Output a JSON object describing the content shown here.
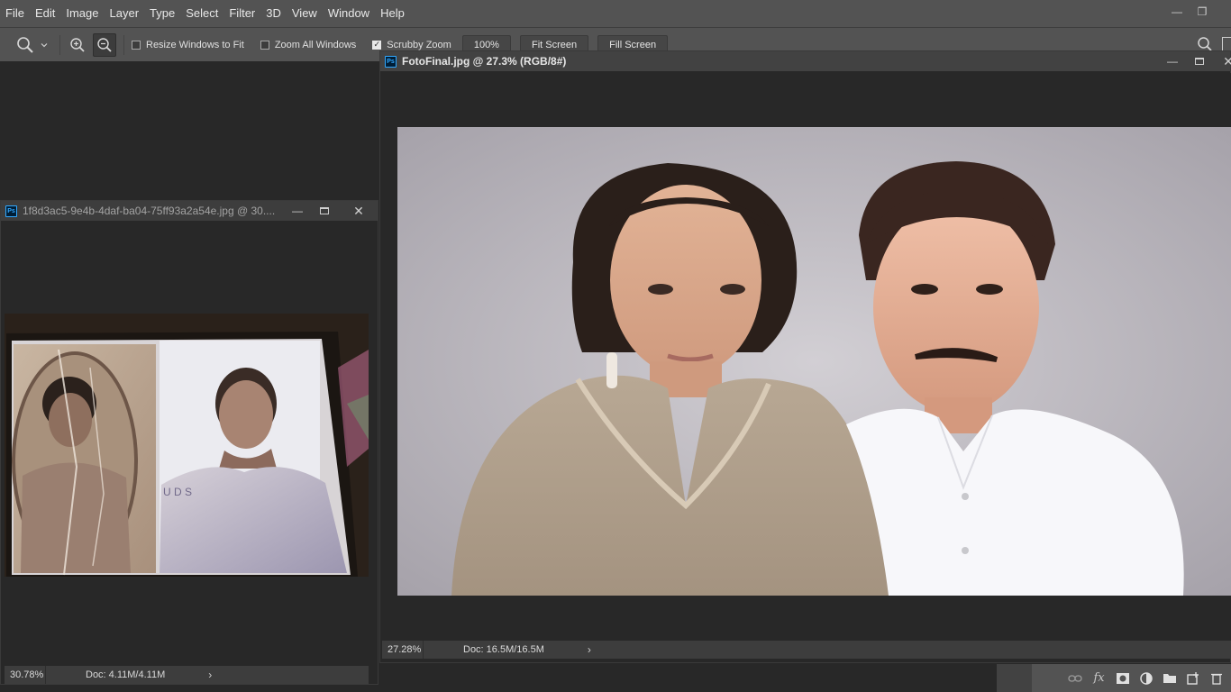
{
  "menu": [
    "File",
    "Edit",
    "Image",
    "Layer",
    "Type",
    "Select",
    "Filter",
    "3D",
    "View",
    "Window",
    "Help"
  ],
  "app_controls": {
    "minimize": "—",
    "restore": "❐"
  },
  "options": {
    "zoom_tool_icon": "zoom-icon",
    "resize_windows_label": "Resize Windows to Fit",
    "resize_windows_checked": false,
    "zoom_all_label": "Zoom All Windows",
    "zoom_all_checked": false,
    "scrubby_label": "Scrubby Zoom",
    "scrubby_checked": true,
    "hundred_label": "100%",
    "fit_label": "Fit Screen",
    "fill_label": "Fill Screen"
  },
  "doc_original": {
    "title": "1f8d3ac5-9e4b-4daf-ba04-75ff93a2a54e.jpg @ 30....",
    "zoom": "30.78%",
    "doc_size": "Doc: 4.11M/4.11M"
  },
  "doc_final": {
    "title": "FotoFinal.jpg @ 27.3% (RGB/8#)",
    "zoom": "27.28%",
    "doc_size": "Doc: 16.5M/16.5M"
  },
  "ps_icon_label": "Ps",
  "status_arrow": "›",
  "layers_panel_icons": [
    "link-icon",
    "fx-icon",
    "mask-icon",
    "adjustment-icon",
    "folder-icon",
    "new-layer-icon",
    "trash-icon"
  ],
  "layers_panel_fx": "fx"
}
